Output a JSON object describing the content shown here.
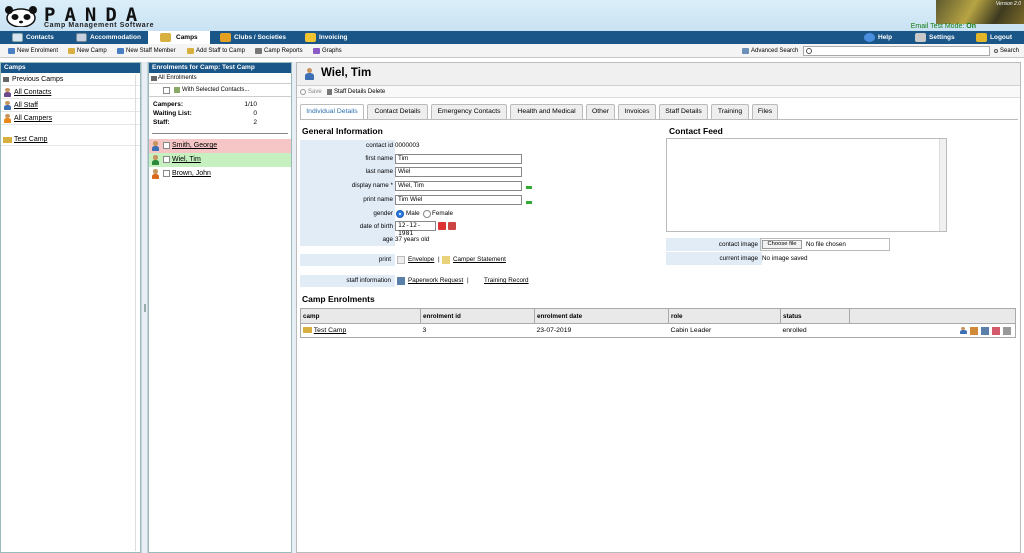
{
  "header": {
    "brand": "PANDA",
    "tagline": "Camp Management Software",
    "version": "Version 2.0",
    "test_mode_label": "Email Test Mode:",
    "test_mode_value": "On"
  },
  "main_nav": [
    {
      "label": "Contacts",
      "icon": "contacts-icon"
    },
    {
      "label": "Accommodation",
      "icon": "accommodation-icon"
    },
    {
      "label": "Camps",
      "icon": "camps-icon"
    },
    {
      "label": "Clubs / Societies",
      "icon": "clubs-icon"
    },
    {
      "label": "Invoicing",
      "icon": "invoicing-icon"
    },
    {
      "label": "Help",
      "icon": "help-icon"
    },
    {
      "label": "Settings",
      "icon": "settings-icon"
    },
    {
      "label": "Logout",
      "icon": "logout-icon"
    }
  ],
  "toolbar": {
    "new_enrolment": "New Enrolment",
    "new_camp": "New Camp",
    "new_staff_member": "New Staff Member",
    "add_staff_to_camp": "Add Staff to Camp",
    "camp_reports": "Camp Reports",
    "graphs": "Graphs",
    "advanced_search": "Advanced Search",
    "search_placeholder": "",
    "search_button": "Search"
  },
  "camps_panel": {
    "title": "Camps",
    "items": [
      {
        "label": "Previous Camps",
        "icon": "folder-icon"
      },
      {
        "label": "All Contacts",
        "icon": "contacts-group-icon"
      },
      {
        "label": "All Staff",
        "icon": "staff-group-icon"
      },
      {
        "label": "All Campers",
        "icon": "campers-group-icon"
      },
      {
        "label": "Test Camp",
        "icon": "camp-icon"
      }
    ]
  },
  "enrolments_panel": {
    "title": "Enrolments for Camp: Test Camp",
    "all_enrolments": "All Enrolments",
    "with_selected": "With Selected Contacts...",
    "stats": [
      {
        "label": "Campers:",
        "value": "1/10"
      },
      {
        "label": "Waiting List:",
        "value": "0"
      },
      {
        "label": "Staff:",
        "value": "2"
      }
    ],
    "people": [
      {
        "name": "Smith, George",
        "status": "red"
      },
      {
        "name": "Wiel, Tim",
        "status": "green"
      },
      {
        "name": "Brown, John",
        "status": "none"
      }
    ]
  },
  "contact": {
    "title": "Wiel, Tim",
    "save_label": "Save",
    "staff_details_delete": "Staff Details Delete",
    "tabs": [
      "Individual Details",
      "Contact Details",
      "Emergency Contacts",
      "Health and Medical",
      "Other",
      "Invoices",
      "Staff Details",
      "Training",
      "Files"
    ],
    "general_info_title": "General Information",
    "contact_feed_title": "Contact Feed",
    "fields": {
      "contact_id_label": "contact id",
      "contact_id": "0000003",
      "first_name_label": "first name",
      "first_name": "Tim",
      "last_name_label": "last name",
      "last_name": "Wiel",
      "display_name_label": "display name *",
      "display_name": "Wiel, Tim",
      "print_name_label": "print name",
      "print_name": "Tim Wiel",
      "gender_label": "gender",
      "gender_male": "Male",
      "gender_female": "Female",
      "dob_label": "date of birth",
      "dob": "12-12-1981",
      "age_label": "age",
      "age": "37 years old",
      "print_label": "print",
      "envelope": "Envelope",
      "separator": "|",
      "camper_statement": "Camper Statement",
      "staff_info_label": "staff information",
      "paperwork_request": "Paperwork Request",
      "training_record": "Training Record",
      "contact_image_label": "contact image",
      "choose_file": "Choose file",
      "no_file": "No file chosen",
      "current_image_label": "current image",
      "no_image": "No image saved"
    },
    "enrolments_title": "Camp Enrolments",
    "enrolment_headers": [
      "camp",
      "enrolment id",
      "enrolment date",
      "role",
      "status",
      ""
    ],
    "enrolment_rows": [
      {
        "camp": "Test Camp",
        "enrolment_id": "3",
        "enrolment_date": "23-07-2019",
        "role": "Cabin Leader",
        "status": "enrolled"
      }
    ]
  }
}
